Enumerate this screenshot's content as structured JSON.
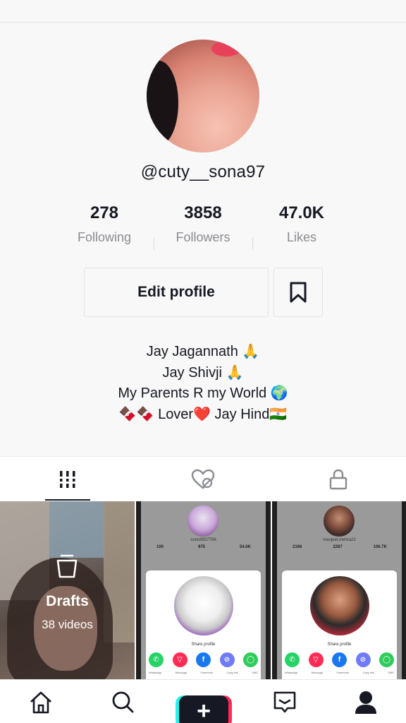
{
  "profile": {
    "username": "@cuty__sona97",
    "stats": [
      {
        "value": "278",
        "label": "Following"
      },
      {
        "value": "3858",
        "label": "Followers"
      },
      {
        "value": "47.0K",
        "label": "Likes"
      }
    ],
    "edit_button": "Edit profile",
    "bio": [
      "Jay Jagannath 🙏",
      "Jay Shivji 🙏",
      "My Parents R my World 🌍",
      "🍫🍫 Lover❤️ Jay Hind🇮🇳"
    ]
  },
  "tabs": [
    {
      "name": "videos",
      "icon": "grid-bars-icon",
      "active": true
    },
    {
      "name": "liked",
      "icon": "heart-hidden-icon",
      "active": false
    },
    {
      "name": "private",
      "icon": "lock-icon",
      "active": false
    }
  ],
  "drafts": {
    "title": "Drafts",
    "count": "38 videos"
  },
  "thumbnails": [
    {
      "mini_user": "sonu9937766",
      "mini_stats": [
        "100",
        "975",
        "54.6K"
      ],
      "sheet_label": "Share profile"
    },
    {
      "mini_user": "manjeet.mehra22",
      "mini_stats": [
        "2166",
        "2287",
        "106.7K"
      ],
      "sheet_label": "Share profile"
    }
  ],
  "share_options": [
    "WhatsApp",
    "Message",
    "Facebook",
    "Copy link",
    "SMS"
  ],
  "nav": [
    {
      "name": "home",
      "icon": "home-icon"
    },
    {
      "name": "discover",
      "icon": "search-icon"
    },
    {
      "name": "create",
      "icon": "plus-icon"
    },
    {
      "name": "inbox",
      "icon": "inbox-icon"
    },
    {
      "name": "me",
      "icon": "profile-icon",
      "active": true
    }
  ],
  "colors": {
    "accent_cyan": "#25f4ee",
    "accent_red": "#fe2c55",
    "text": "#161823",
    "muted": "#8a8b91"
  }
}
